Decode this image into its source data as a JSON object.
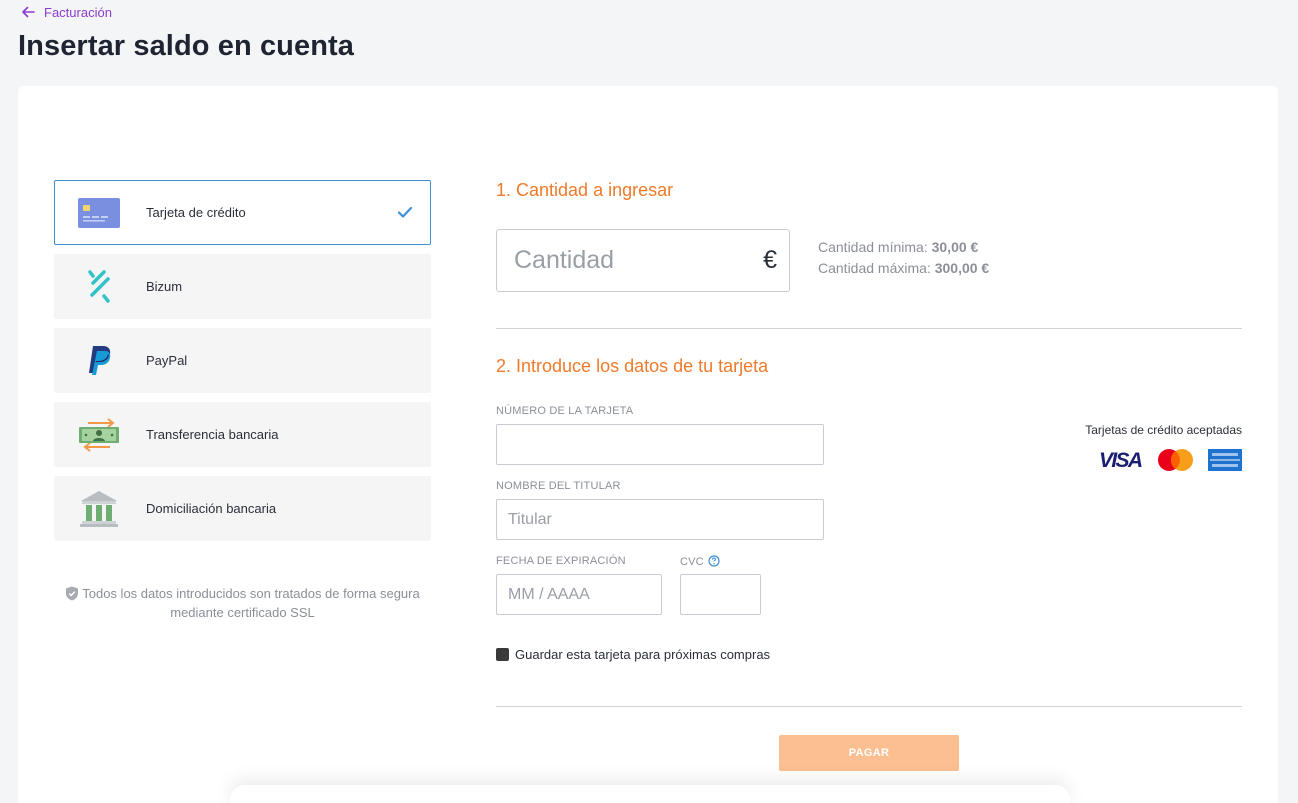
{
  "header": {
    "back_label": "Facturación",
    "title": "Insertar saldo en cuenta"
  },
  "methods": [
    {
      "label": "Tarjeta de crédito",
      "icon": "credit-card-icon",
      "selected": true
    },
    {
      "label": "Bizum",
      "icon": "bizum-icon",
      "selected": false
    },
    {
      "label": "PayPal",
      "icon": "paypal-icon",
      "selected": false
    },
    {
      "label": "Transferencia bancaria",
      "icon": "bank-transfer-icon",
      "selected": false
    },
    {
      "label": "Domiciliación bancaria",
      "icon": "bank-building-icon",
      "selected": false
    }
  ],
  "secure_note": "Todos los datos introducidos son tratados de forma segura mediante certificado SSL",
  "amount": {
    "section_title": "1. Cantidad a ingresar",
    "placeholder": "Cantidad",
    "currency": "€",
    "min_label": "Cantidad mínima:",
    "min_value": "30,00 €",
    "max_label": "Cantidad máxima:",
    "max_value": "300,00 €"
  },
  "card_form": {
    "section_title": "2. Introduce los datos de tu tarjeta",
    "number_label": "NÚMERO DE LA TARJETA",
    "number_placeholder": "",
    "holder_label": "NOMBRE DEL TITULAR",
    "holder_placeholder": "Titular",
    "expiry_label": "FECHA DE EXPIRACIÓN",
    "expiry_placeholder": "MM / AAAA",
    "cvc_label": "CVC",
    "cvc_placeholder": "",
    "accepted_label": "Tarjetas de crédito aceptadas",
    "accepted_cards": [
      "visa",
      "mastercard",
      "american-express"
    ],
    "save_card_label": "Guardar esta tarjeta para próximas compras",
    "pay_label": "PAGAR"
  },
  "colors": {
    "accent": "#ef7a2a",
    "link": "#8a3ccf",
    "selected_border": "#3f8fd4",
    "pay_button": "#fcbf91"
  }
}
